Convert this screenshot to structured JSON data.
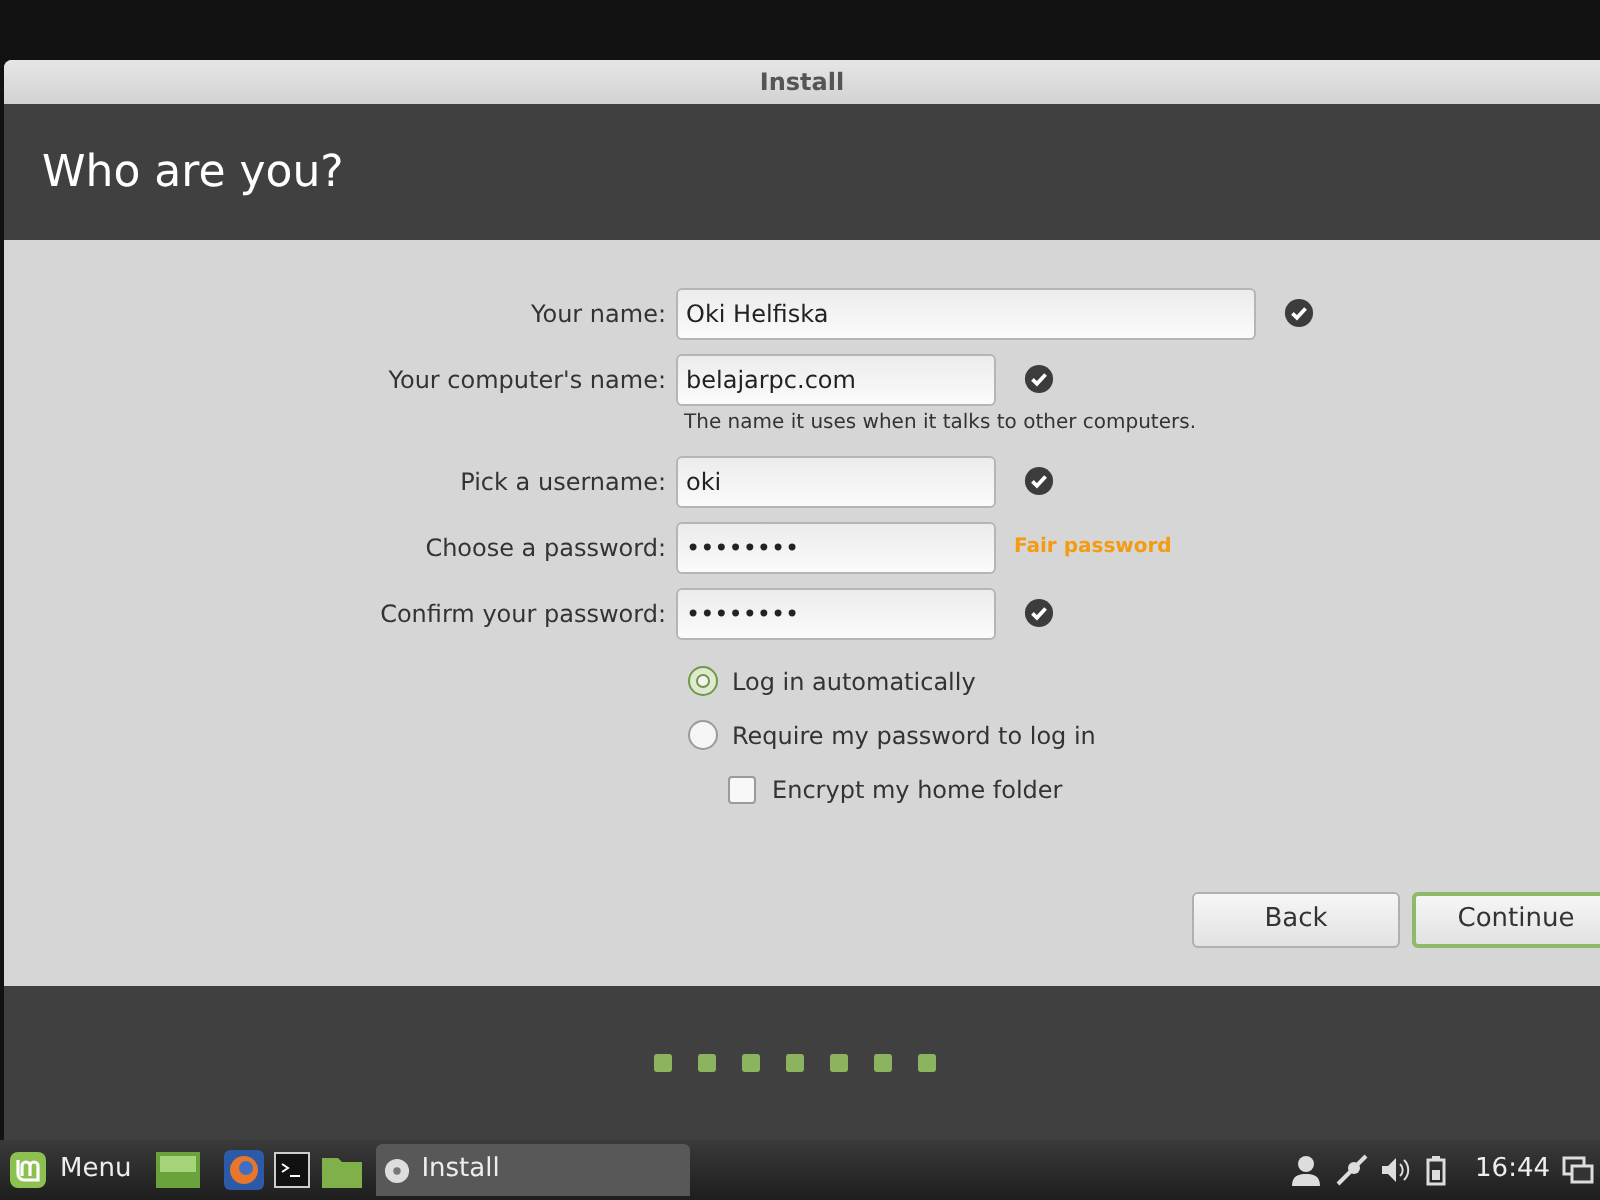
{
  "window": {
    "title": "Install"
  },
  "header": {
    "title": "Who are you?"
  },
  "fields": [
    {
      "label": "Your name:",
      "value": "Oki Helfiska",
      "wide": true,
      "valid": true
    },
    {
      "label": "Your computer's name:",
      "value": "belajarpc.com",
      "wide": false,
      "valid": true,
      "hint": "The name it uses when it talks to other computers."
    },
    {
      "label": "Pick a username:",
      "value": "oki",
      "wide": false,
      "valid": true
    },
    {
      "label": "Choose a password:",
      "value": "••••••••",
      "wide": false,
      "valid": false,
      "message": "Fair password"
    },
    {
      "label": "Confirm your password:",
      "value": "••••••••",
      "wide": false,
      "valid": true
    }
  ],
  "login_options": [
    {
      "kind": "radio",
      "label": "Log in automatically",
      "selected": true
    },
    {
      "kind": "radio",
      "label": "Require my password to log in",
      "selected": false
    },
    {
      "kind": "checkbox",
      "label": "Encrypt my home folder",
      "checked": false
    }
  ],
  "buttons": [
    {
      "label": "Back",
      "default": false
    },
    {
      "label": "Continue",
      "default": true
    }
  ],
  "taskbar": {
    "menu": "Menu",
    "windows": [
      {
        "label": "Install",
        "selected": true
      }
    ],
    "clock": "16:44"
  }
}
